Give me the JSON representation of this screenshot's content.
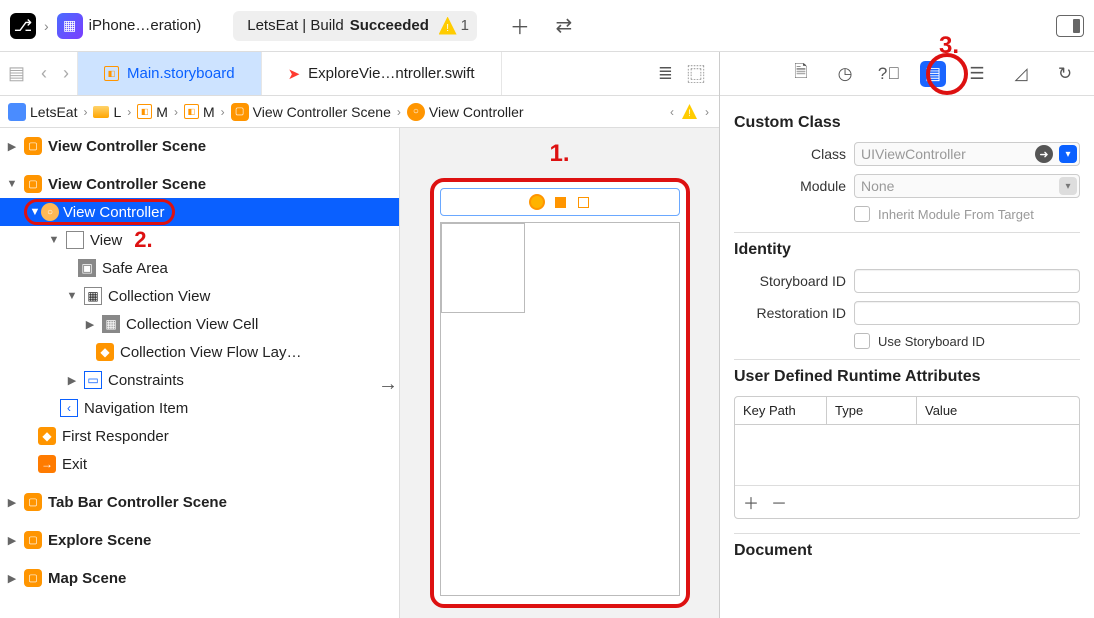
{
  "toolbar": {
    "target": "iPhone…eration)",
    "status_prefix": "LetsEat | Build ",
    "status_bold": "Succeeded",
    "warn_count": "1"
  },
  "tabs": {
    "active": "Main.storyboard",
    "other": "ExploreVie…ntroller.swift"
  },
  "breadcrumb": {
    "p0": "LetsEat",
    "p1": "L",
    "p2": "M",
    "p3": "M",
    "p4": "View Controller Scene",
    "p5": "View Controller"
  },
  "navigator": {
    "scene1": "View Controller Scene",
    "scene2": "View Controller Scene",
    "vc": "View Controller",
    "view": "View",
    "safe": "Safe Area",
    "coll": "Collection View",
    "cell": "Collection View Cell",
    "flow": "Collection View Flow Lay…",
    "constraints": "Constraints",
    "navitem": "Navigation Item",
    "first": "First Responder",
    "exit": "Exit",
    "tabbar": "Tab Bar Controller Scene",
    "explore": "Explore Scene",
    "map": "Map Scene"
  },
  "annotations": {
    "one": "1.",
    "two": "2.",
    "three": "3."
  },
  "inspector": {
    "custom_class": "Custom Class",
    "class_label": "Class",
    "class_placeholder": "UIViewController",
    "module_label": "Module",
    "module_placeholder": "None",
    "inherit": "Inherit Module From Target",
    "identity": "Identity",
    "sbid_label": "Storyboard ID",
    "restid_label": "Restoration ID",
    "use_sbid": "Use Storyboard ID",
    "runtime": "User Defined Runtime Attributes",
    "col_key": "Key Path",
    "col_type": "Type",
    "col_value": "Value",
    "document": "Document"
  }
}
